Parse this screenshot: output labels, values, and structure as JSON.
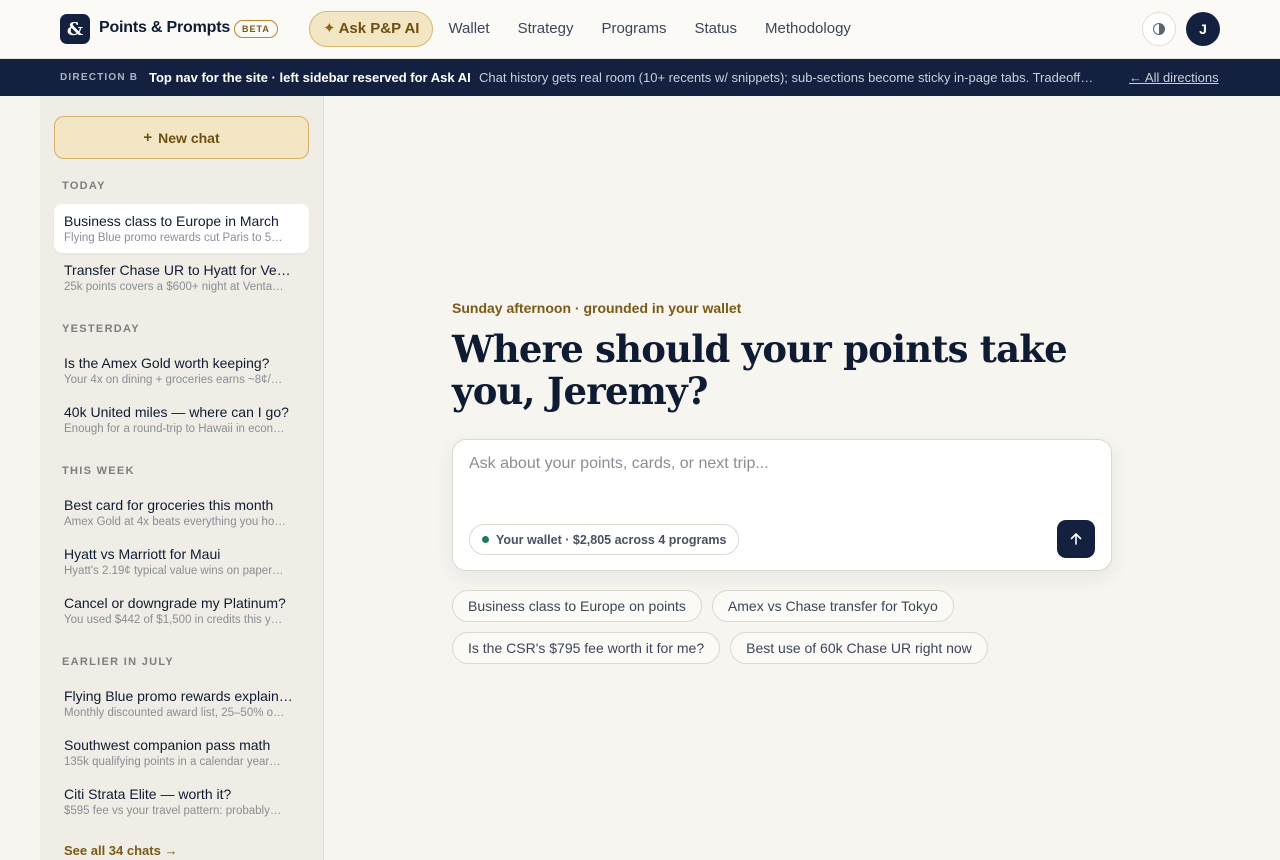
{
  "brand": {
    "logo_glyph": "&",
    "name": "Points & Prompts",
    "badge": "BETA"
  },
  "nav": {
    "items": [
      {
        "label": "Ask P&P AI",
        "icon": "sparkle-icon",
        "active": true
      },
      {
        "label": "Wallet"
      },
      {
        "label": "Strategy"
      },
      {
        "label": "Programs"
      },
      {
        "label": "Status"
      },
      {
        "label": "Methodology"
      }
    ],
    "spark_glyph": "✦",
    "theme_toggle_icon": "contrast-icon",
    "avatar_initial": "J"
  },
  "banner": {
    "tag": "DIRECTION B",
    "title": "Top nav for the site · left sidebar reserved for Ask AI",
    "description": "Chat history gets real room (10+ recents w/ snippets); sub-sections become sticky in-page tabs. Tradeoff…",
    "link": "← All directions"
  },
  "sidebar": {
    "new_chat_label": "New chat",
    "new_chat_icon": "plus-icon",
    "groups": [
      {
        "label": "TODAY",
        "chats": [
          {
            "title": "Business class to Europe in March",
            "snippet": "Flying Blue promo rewards cut Paris to 5…",
            "selected": true
          },
          {
            "title": "Transfer Chase UR to Hyatt for Ve…",
            "snippet": "25k points covers a $600+ night at Venta…"
          }
        ]
      },
      {
        "label": "YESTERDAY",
        "chats": [
          {
            "title": "Is the Amex Gold worth keeping?",
            "snippet": "Your 4x on dining + groceries earns ~8¢/…"
          },
          {
            "title": "40k United miles — where can I go?",
            "snippet": "Enough for a round-trip to Hawaii in econ…"
          }
        ]
      },
      {
        "label": "THIS WEEK",
        "chats": [
          {
            "title": "Best card for groceries this month",
            "snippet": "Amex Gold at 4x beats everything you ho…"
          },
          {
            "title": "Hyatt vs Marriott for Maui",
            "snippet": "Hyatt's 2.19¢ typical value wins on paper…"
          },
          {
            "title": "Cancel or downgrade my Platinum?",
            "snippet": "You used $442 of $1,500 in credits this y…"
          }
        ]
      },
      {
        "label": "EARLIER IN JULY",
        "chats": [
          {
            "title": "Flying Blue promo rewards explain…",
            "snippet": "Monthly discounted award list, 25–50% o…"
          },
          {
            "title": "Southwest companion pass math",
            "snippet": "135k qualifying points in a calendar year…"
          },
          {
            "title": "Citi Strata Elite — worth it?",
            "snippet": "$595 fee vs your travel pattern: probably…"
          }
        ]
      }
    ],
    "see_all": "See all 34 chats →"
  },
  "main": {
    "eyebrow": "Sunday afternoon · grounded in your wallet",
    "headline": "Where should your points take you, Jeremy?",
    "composer": {
      "placeholder": "Ask about your points, cards, or next trip...",
      "value": "",
      "wallet_chip": "Your wallet · $2,805 across 4 programs",
      "wallet_status_color": "#1f7a5a",
      "send_icon": "arrow-up-icon"
    },
    "suggestions": [
      "Business class to Europe on points",
      "Amex vs Chase transfer for Tokyo",
      "Is the CSR's $795 fee worth it for me?",
      "Best use of 60k Chase UR right now"
    ]
  },
  "colors": {
    "navy": "#13203f",
    "gold": "#7a5a16",
    "gold_fill": "#f3e6c5",
    "background": "#f6f5f0"
  }
}
